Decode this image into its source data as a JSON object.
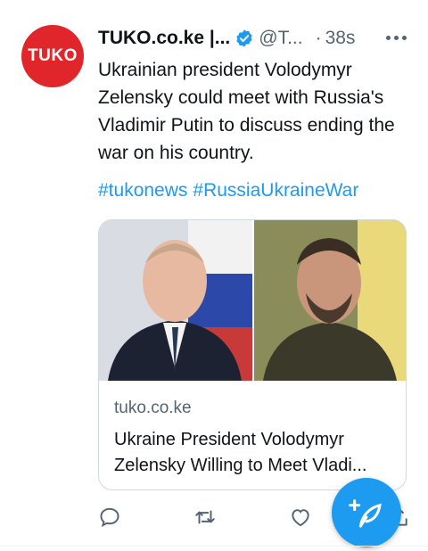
{
  "tweet": {
    "author_name": "TUKO.co.ke |...",
    "handle": "@T...",
    "separator": "·",
    "time": "38s",
    "avatar_text": "TUKO",
    "text": "Ukrainian president Volodymyr Zelensky could meet with Russia's Vladimir Putin to discuss ending the war on his country.",
    "hashtags": [
      "#tukonews",
      "#RussiaUkraineWar"
    ]
  },
  "card": {
    "domain": "tuko.co.ke",
    "title": "Ukraine President Volodymyr Zelensky Willing to Meet Vladi..."
  },
  "icons": [
    "more-icon",
    "verified-badge-icon",
    "reply-icon",
    "retweet-icon",
    "like-icon",
    "share-icon",
    "compose-tweet-icon"
  ],
  "colors": {
    "accent": "#1d9bf0",
    "brand": "#e1262b",
    "text": "#0f1419",
    "muted": "#536471"
  }
}
